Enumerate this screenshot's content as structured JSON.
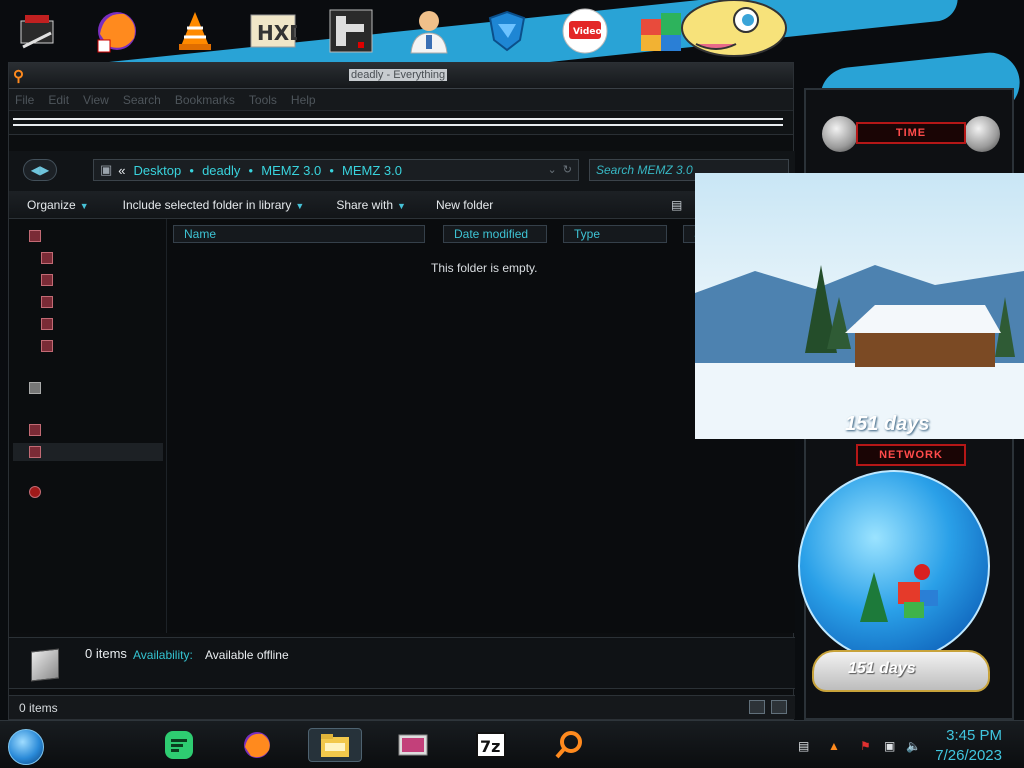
{
  "window": {
    "title": "deadly - Everything",
    "menu": [
      "File",
      "Edit",
      "View",
      "Search",
      "Bookmarks",
      "Tools",
      "Help"
    ]
  },
  "address": {
    "crumbs": [
      "Desktop",
      "deadly",
      "MEMZ 3.0",
      "MEMZ 3.0"
    ],
    "overflow": "«"
  },
  "search": {
    "placeholder": "Search MEMZ 3.0"
  },
  "toolbar": {
    "organize": "Organize",
    "include_library": "Include selected folder in library",
    "share_with": "Share with",
    "new_folder": "New folder"
  },
  "columns": [
    "Name",
    "Date modified",
    "Type",
    "Si"
  ],
  "content": {
    "empty_message": "This folder is empty."
  },
  "details": {
    "count": "0 items",
    "availability_label": "Availability:",
    "availability_value": "Available offline"
  },
  "statusbar": {
    "text": "0 items"
  },
  "gadgets": {
    "time_label": "TIME",
    "network_label": "NETWORK",
    "countdown_text": "151 days"
  },
  "desktop_icons": [
    "toolbox-icon",
    "firefox-shortcut-icon",
    "vlc-shortcut-icon",
    "hxd-shortcut-icon",
    "game-shortcut-icon",
    "doctor-icon",
    "shield-icon",
    "fast-video-downloader-icon",
    "color-blocks-icon",
    "cartoon-face-icon"
  ],
  "taskbar": {
    "apps": [
      "spotify-icon",
      "firefox-icon",
      "explorer-icon",
      "video-icon",
      "7zip-icon",
      "search-everything-icon"
    ],
    "time": "3:45 PM",
    "date": "7/26/2023"
  },
  "colors": {
    "accent_cyan": "#39d3dd",
    "gadget_red": "#ff4b4b",
    "desktop_blue": "#29a3d6"
  }
}
